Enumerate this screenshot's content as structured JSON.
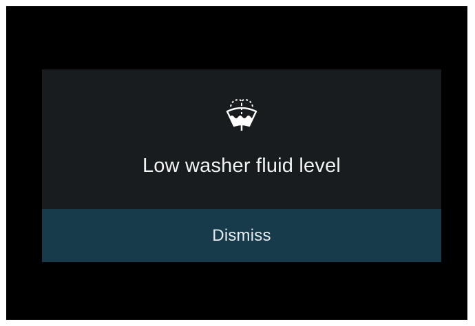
{
  "notification": {
    "icon": "washer-fluid-icon",
    "message": "Low washer fluid level",
    "dismiss_label": "Dismiss"
  },
  "colors": {
    "screen_background": "#000000",
    "panel_background": "#181c1e",
    "button_background": "#183b4c",
    "text": "#f2f4f4"
  }
}
